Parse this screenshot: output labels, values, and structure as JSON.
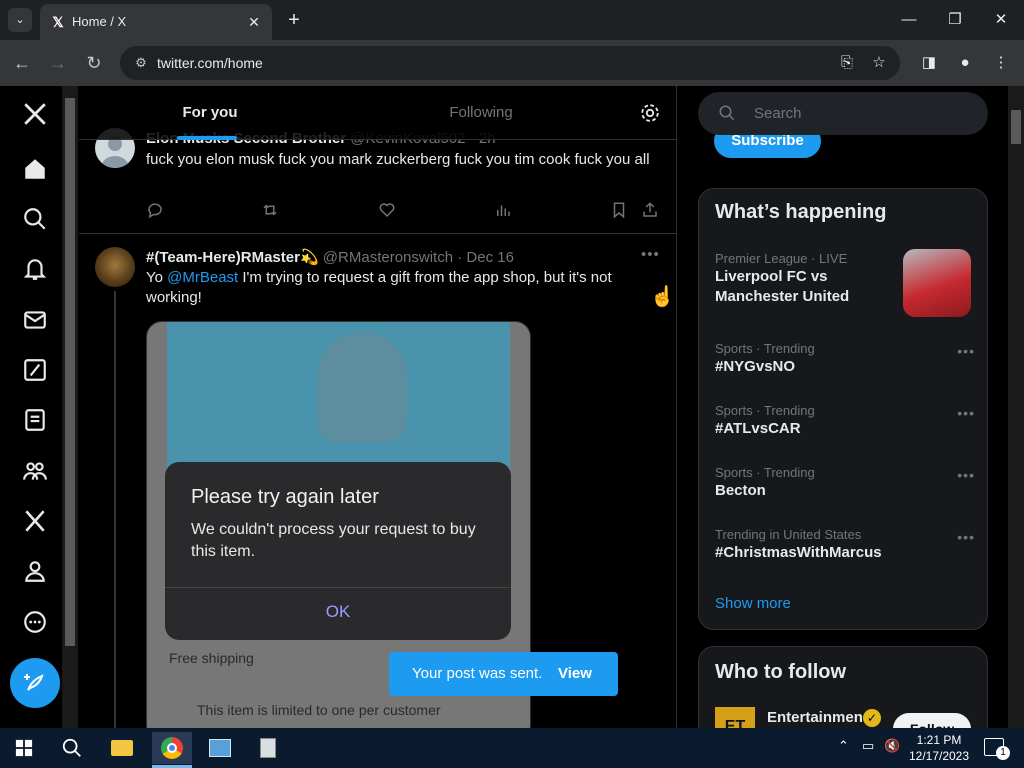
{
  "browser": {
    "tab_title": "Home / X",
    "url": "twitter.com/home"
  },
  "timeline": {
    "tabs": [
      {
        "label": "For you",
        "active": true
      },
      {
        "label": "Following",
        "active": false
      }
    ],
    "tweets": [
      {
        "display_name_partial": "Elon Musks Second Brother",
        "handle_partial": "@KevinKoval502 · 2h",
        "text": "fuck you elon musk fuck you mark zuckerberg fuck you tim cook fuck you all"
      },
      {
        "display_name": "#(Team-Here)RMaster💫",
        "handle": "@RMasteronswitch",
        "date": "· Dec 16",
        "text_prefix": "Yo ",
        "mention": "@MrBeast",
        "text_suffix": " I'm trying to request a gift from the app shop, but it's not working!",
        "media": {
          "dialog_title": "Please try again later",
          "dialog_body": "We couldn't process your request to buy this item.",
          "dialog_ok": "OK",
          "line1": "Free shipping",
          "line2": "This item is limited to one per customer"
        }
      }
    ]
  },
  "right": {
    "search_placeholder": "Search",
    "subscribe_label": "Subscribe",
    "happening_title": "What’s happening",
    "trends": [
      {
        "meta": "Premier League · LIVE",
        "name": "Liverpool FC vs Manchester United"
      },
      {
        "meta": "Sports · Trending",
        "name": "#NYGvsNO"
      },
      {
        "meta": "Sports · Trending",
        "name": "#ATLvsCAR"
      },
      {
        "meta": "Sports · Trending",
        "name": "Becton"
      },
      {
        "meta": "Trending in United States",
        "name": "#ChristmasWithMarcus"
      }
    ],
    "show_more": "Show more",
    "who_to_follow_title": "Who to follow",
    "follow_suggestion": {
      "name": "Entertainment",
      "follow_label": "Follow"
    }
  },
  "toast": {
    "text": "Your post was sent.",
    "action": "View"
  },
  "taskbar": {
    "time": "1:21 PM",
    "date": "12/17/2023",
    "notif_count": "1"
  },
  "colors": {
    "accent": "#1d9bf0",
    "bg": "#000000",
    "panel": "#16181c",
    "muted": "#71767b"
  }
}
